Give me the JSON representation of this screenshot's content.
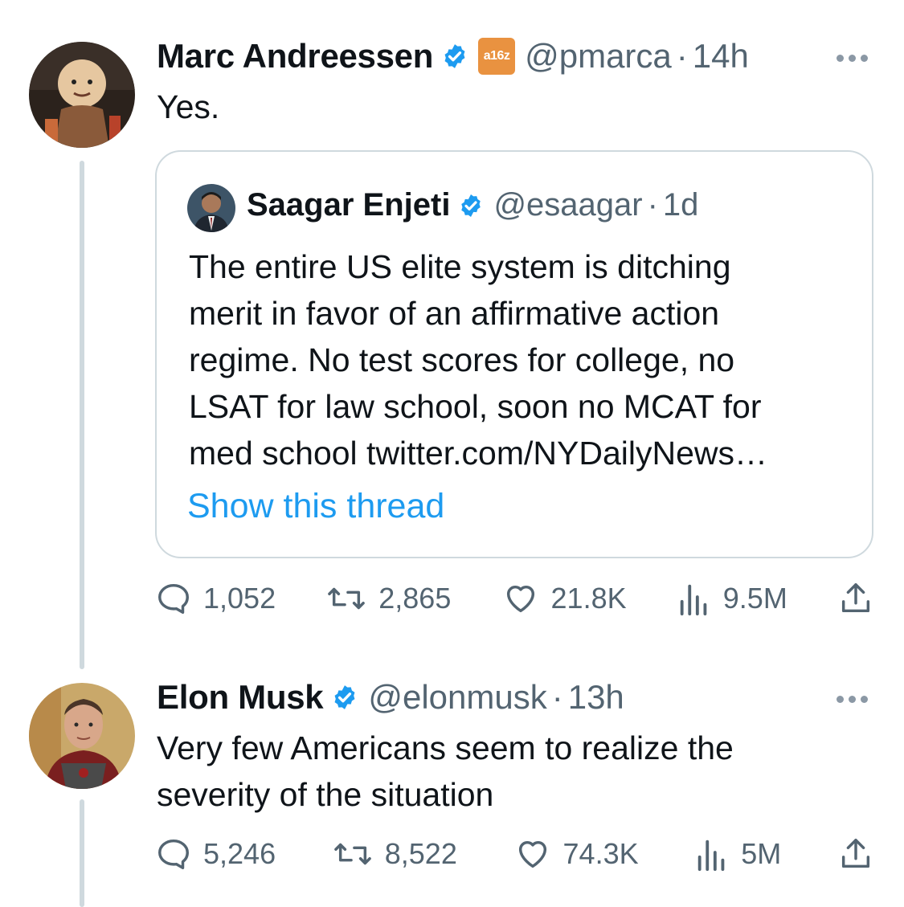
{
  "colors": {
    "text_primary": "#0f1419",
    "text_secondary": "#536471",
    "link_blue": "#1d9bf0",
    "verified_blue": "#1d9bf0",
    "thread_line": "#cfd9de",
    "org_badge": "#e99240"
  },
  "tweets": [
    {
      "author": {
        "name": "Marc Andreessen",
        "handle": "@pmarca",
        "verified_icon": "verified-badge-icon",
        "org_badge_text": "a16z"
      },
      "dot": "·",
      "time": "14h",
      "text": "Yes.",
      "quoted": {
        "author": {
          "name": "Saagar Enjeti",
          "handle": "@esaagar",
          "verified_icon": "verified-badge-icon"
        },
        "dot": "·",
        "time": "1d",
        "lines": [
          "The entire US elite system is ditching",
          "merit in favor of an affirmative action",
          "regime. No test scores for college, no",
          "LSAT for law school, soon no MCAT for",
          "med school twitter.com/NYDailyNews…"
        ],
        "show_thread": "Show this thread"
      },
      "stats": {
        "replies": "1,052",
        "retweets": "2,865",
        "likes": "21.8K",
        "views": "9.5M"
      }
    },
    {
      "author": {
        "name": "Elon Musk",
        "handle": "@elonmusk",
        "verified_icon": "verified-badge-icon"
      },
      "dot": "·",
      "time": "13h",
      "lines": [
        "Very few Americans seem to realize the",
        "severity of the situation"
      ],
      "stats": {
        "replies": "5,246",
        "retweets": "8,522",
        "likes": "74.3K",
        "views": "5M"
      }
    }
  ]
}
